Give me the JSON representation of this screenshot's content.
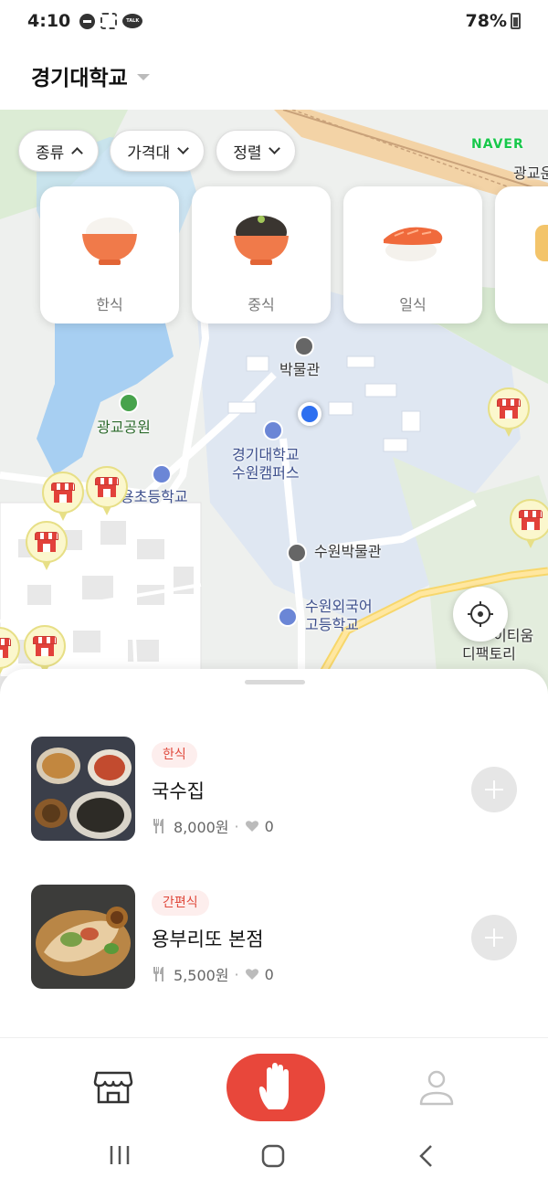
{
  "status_bar": {
    "time": "4:10",
    "battery": "78%"
  },
  "header": {
    "title": "경기대학교"
  },
  "map": {
    "filters": [
      {
        "label": "종류",
        "state": "expanded"
      },
      {
        "label": "가격대",
        "state": "collapsed"
      },
      {
        "label": "정렬",
        "state": "collapsed"
      }
    ],
    "provider": "NAVER",
    "categories": [
      {
        "label": "한식",
        "icon": "rice-bowl-icon"
      },
      {
        "label": "중식",
        "icon": "black-bean-noodles-icon"
      },
      {
        "label": "일식",
        "icon": "sushi-icon"
      }
    ],
    "pois": {
      "museum": "박물관",
      "park": "광교공원",
      "campus_line1": "경기대학교",
      "campus_line2": "수원캠퍼스",
      "school": "용초등학교",
      "suwon_museum": "수원박물관",
      "foreign_school_line1": "수원외국어",
      "foreign_school_line2": "고등학교",
      "factory_line1": "이티움",
      "factory_line2": "디팩토리",
      "gwanggyo_edge": "광교운"
    }
  },
  "restaurants": [
    {
      "category": "한식",
      "name": "국수집",
      "price": "8,000원",
      "likes": "0"
    },
    {
      "category": "간편식",
      "name": "용부리또 본점",
      "price": "5,500원",
      "likes": "0"
    }
  ],
  "colors": {
    "accent": "#e8473b",
    "tag_bg": "#fdeeed",
    "naver_green": "#18c84b",
    "user_location": "#2d6ff0"
  },
  "bottom_nav": {
    "items": [
      "store-icon",
      "hand-icon",
      "user-icon"
    ],
    "active": "hand-icon"
  }
}
